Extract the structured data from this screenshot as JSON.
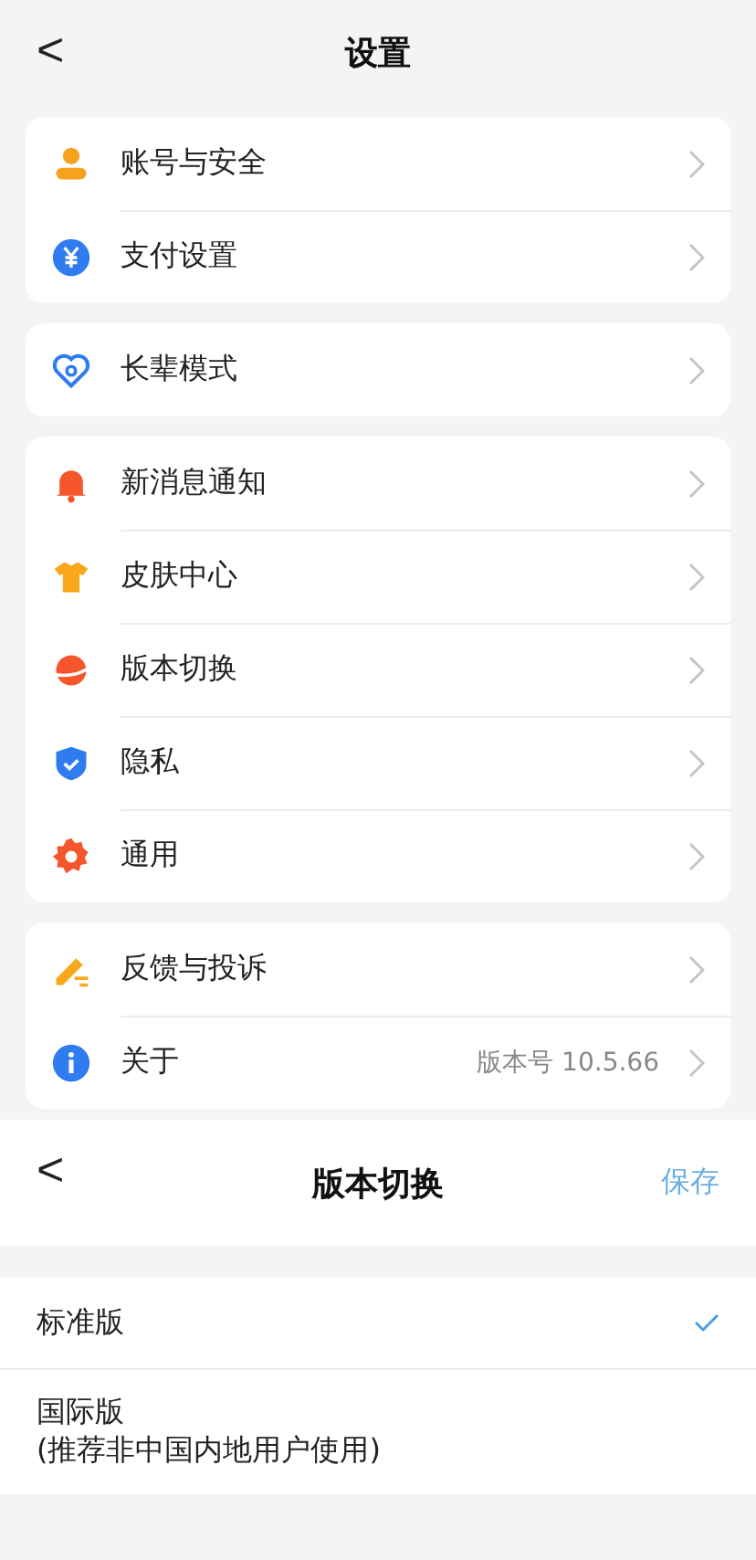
{
  "settings": {
    "back": "<",
    "title": "设置",
    "groups": [
      {
        "items": [
          {
            "kind": "person",
            "label": "账号与安全"
          },
          {
            "kind": "yen",
            "label": "支付设置"
          }
        ]
      },
      {
        "items": [
          {
            "kind": "heart",
            "label": "长辈模式"
          }
        ]
      },
      {
        "items": [
          {
            "kind": "bell",
            "label": "新消息通知"
          },
          {
            "kind": "shirt",
            "label": "皮肤中心"
          },
          {
            "kind": "planet",
            "label": "版本切换"
          },
          {
            "kind": "shield",
            "label": "隐私"
          },
          {
            "kind": "gear",
            "label": "通用"
          }
        ]
      },
      {
        "items": [
          {
            "kind": "pencil",
            "label": "反馈与投诉"
          },
          {
            "kind": "info",
            "label": "关于",
            "value": "版本号 10.5.66"
          }
        ]
      }
    ]
  },
  "version_switch": {
    "back": "<",
    "title": "版本切换",
    "save": "保存",
    "options": [
      {
        "label": "标准版",
        "selected": true
      },
      {
        "label": "国际版",
        "note": "(推荐非中国内地用户使用)",
        "selected": false
      }
    ]
  }
}
